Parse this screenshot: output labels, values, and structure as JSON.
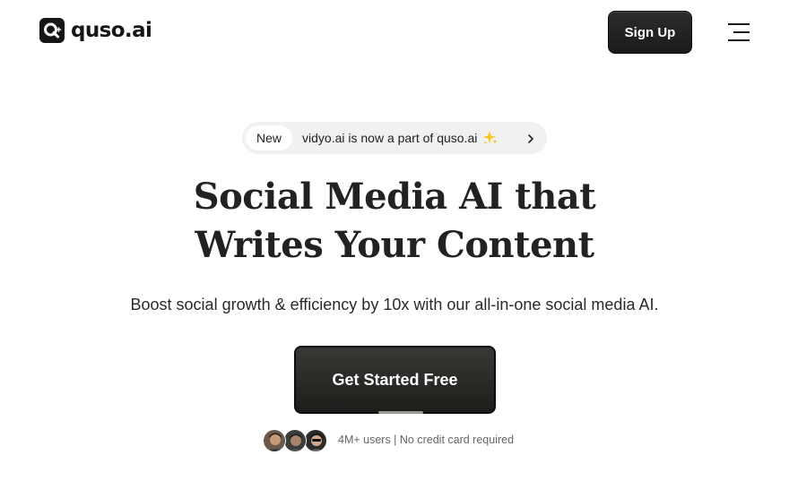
{
  "header": {
    "brand": "quso.ai",
    "signup_label": "Sign Up"
  },
  "announcement": {
    "badge": "New",
    "text": "vidyo.ai is now a part of quso.ai",
    "sparkle_icon": "sparkles-icon"
  },
  "hero": {
    "title_line1": "Social Media AI that",
    "title_line2": "Writes Your Content",
    "subtitle": "Boost social growth & efficiency by 10x with our all-in-one social media AI.",
    "cta_label": "Get Started Free"
  },
  "social_proof": {
    "text": "4M+ users | No credit card required",
    "avatar_count": 3
  },
  "colors": {
    "primary_dark": "#1b1b1b",
    "pill_bg": "#f1f1f1",
    "sparkle": "#f5c518"
  }
}
